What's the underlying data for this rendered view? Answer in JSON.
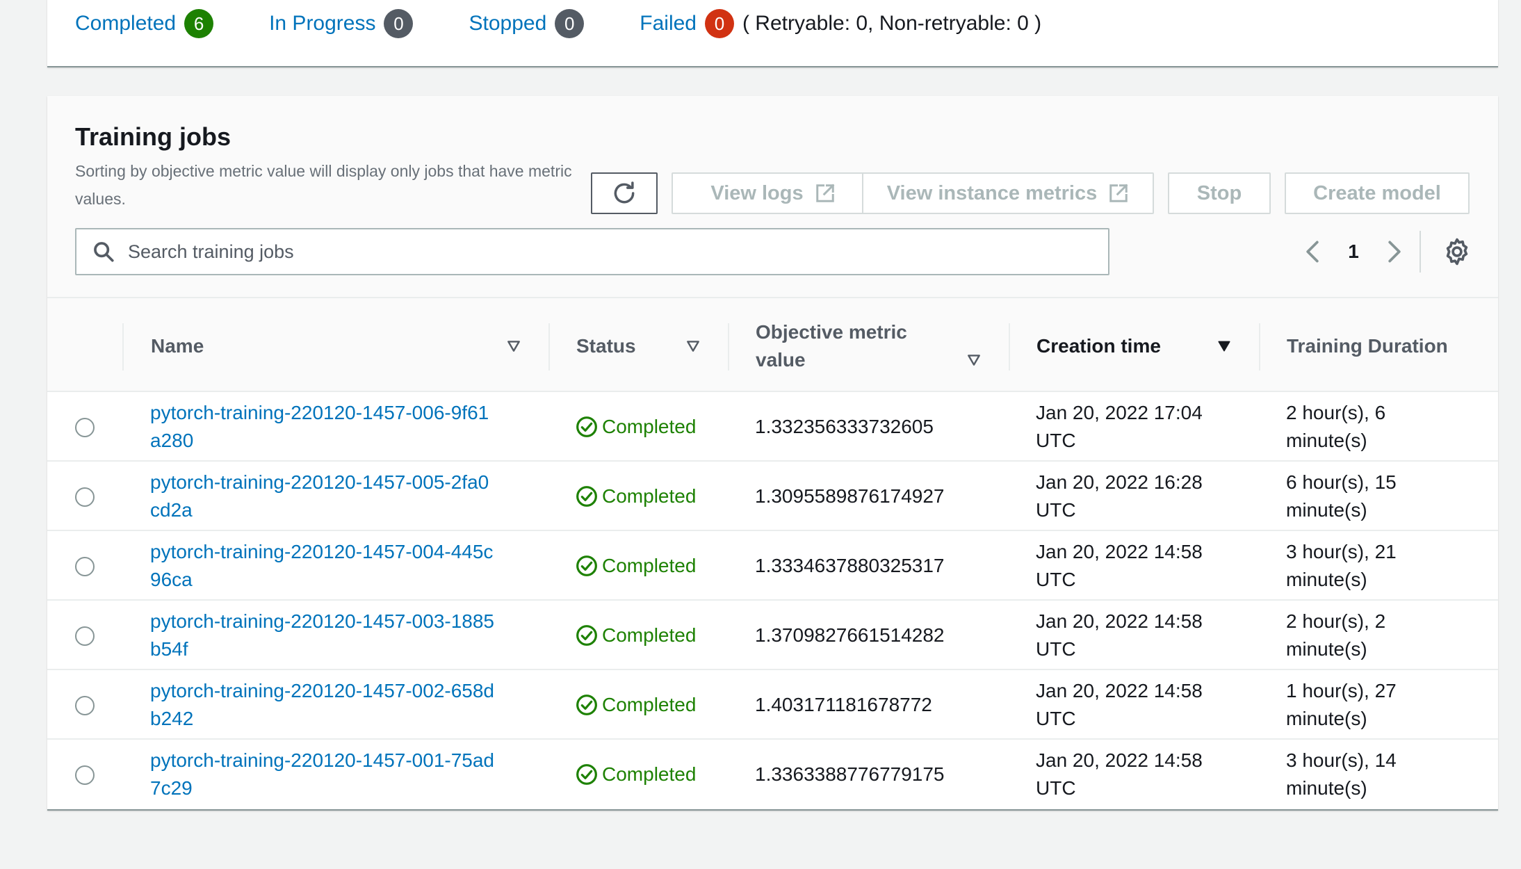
{
  "summary": {
    "completed": {
      "label": "Completed",
      "count": "6"
    },
    "in_progress": {
      "label": "In Progress",
      "count": "0"
    },
    "stopped": {
      "label": "Stopped",
      "count": "0"
    },
    "failed": {
      "label": "Failed",
      "count": "0",
      "note": "( Retryable: 0, Non-retryable: 0 )"
    }
  },
  "panel": {
    "title": "Training jobs",
    "description": "Sorting by objective metric value will display only jobs that have metric values."
  },
  "toolbar": {
    "view_logs": "View logs",
    "view_instance_metrics": "View instance metrics",
    "stop": "Stop",
    "create_model": "Create model"
  },
  "search": {
    "placeholder": "Search training jobs",
    "value": ""
  },
  "pagination": {
    "current_page": "1"
  },
  "table": {
    "columns": {
      "name": "Name",
      "status": "Status",
      "objective": "Objective metric value",
      "creation_time": "Creation time",
      "duration": "Training Duration"
    },
    "rows": [
      {
        "name": "pytorch-training-220120-1457-006-9f61a280",
        "status": "Completed",
        "objective": "1.332356333732605",
        "creation_time": "Jan 20, 2022 17:04 UTC",
        "duration": "2 hour(s), 6 minute(s)"
      },
      {
        "name": "pytorch-training-220120-1457-005-2fa0cd2a",
        "status": "Completed",
        "objective": "1.3095589876174927",
        "creation_time": "Jan 20, 2022 16:28 UTC",
        "duration": "6 hour(s), 15 minute(s)"
      },
      {
        "name": "pytorch-training-220120-1457-004-445c96ca",
        "status": "Completed",
        "objective": "1.3334637880325317",
        "creation_time": "Jan 20, 2022 14:58 UTC",
        "duration": "3 hour(s), 21 minute(s)"
      },
      {
        "name": "pytorch-training-220120-1457-003-1885b54f",
        "status": "Completed",
        "objective": "1.3709827661514282",
        "creation_time": "Jan 20, 2022 14:58 UTC",
        "duration": "2 hour(s), 2 minute(s)"
      },
      {
        "name": "pytorch-training-220120-1457-002-658db242",
        "status": "Completed",
        "objective": "1.403171181678772",
        "creation_time": "Jan 20, 2022 14:58 UTC",
        "duration": "1 hour(s), 27 minute(s)"
      },
      {
        "name": "pytorch-training-220120-1457-001-75ad7c29",
        "status": "Completed",
        "objective": "1.3363388776779175",
        "creation_time": "Jan 20, 2022 14:58 UTC",
        "duration": "3 hour(s), 14 minute(s)"
      }
    ]
  },
  "colors": {
    "link": "#0073bb",
    "success": "#1d8102",
    "badge_grey": "#545b64",
    "error": "#d13212"
  },
  "icons": {
    "refresh": "refresh-icon",
    "external": "external-link-icon",
    "search": "search-icon",
    "prev": "chevron-left-icon",
    "next": "chevron-right-icon",
    "settings": "gear-icon",
    "sort": "sort-triangle-icon",
    "status": "check-circle-icon"
  }
}
